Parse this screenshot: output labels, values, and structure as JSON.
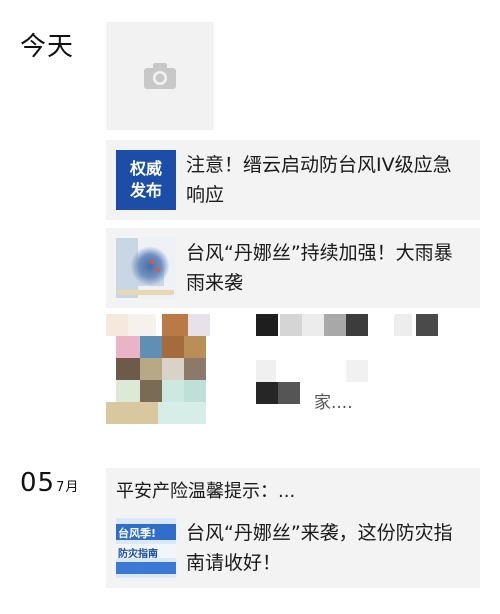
{
  "timeline": {
    "today_label": "今天",
    "date_day": "05",
    "date_month": "7月"
  },
  "posts": [
    {
      "thumb_line1": "权威",
      "thumb_line2": "发布",
      "title": "注意！缙云启动防台风IV级应急响应"
    },
    {
      "title": "台风“丹娜丝”持续加强！大雨暴雨来袭"
    },
    {
      "blurred_text": "家...."
    },
    {
      "title": "平安产险温馨提示：..."
    },
    {
      "thumb_line1": "台风季!",
      "thumb_line2": "防灾指南",
      "title": "台风“丹娜丝”来袭，这份防灾指南请收好！"
    }
  ],
  "icons": {
    "camera": "camera-icon"
  },
  "colors": {
    "card_bg": "#f3f3f3",
    "official_blue": "#1c4ea8"
  }
}
